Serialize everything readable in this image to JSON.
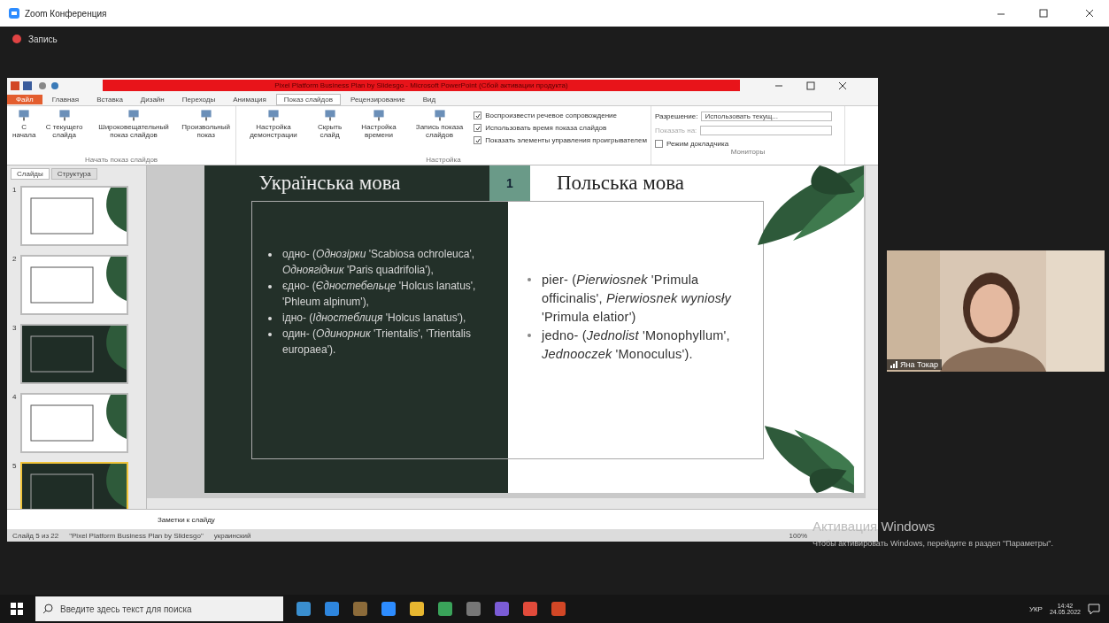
{
  "zoom": {
    "title": "Zoom Конференция",
    "record_label": "Запись"
  },
  "powerpoint": {
    "title": "Pixel Platform Business Plan by Slidesgo - Microsoft PowerPoint (Сбой активации продукта)",
    "file_tab": "Файл",
    "ribbon_tabs": [
      {
        "label": "Главная",
        "selected": false
      },
      {
        "label": "Вставка",
        "selected": false
      },
      {
        "label": "Дизайн",
        "selected": false
      },
      {
        "label": "Переходы",
        "selected": false
      },
      {
        "label": "Анимация",
        "selected": false
      },
      {
        "label": "Показ слайдов",
        "selected": true
      },
      {
        "label": "Рецензирование",
        "selected": false
      },
      {
        "label": "Вид",
        "selected": false
      }
    ],
    "groups": [
      {
        "label": "Начать показ слайдов",
        "buttons": [
          "С начала",
          "С текущего слайда",
          "Широковещательный показ слайдов",
          "Произвольный показ"
        ]
      },
      {
        "label": "Настройка",
        "buttons": [
          "Настройка демонстрации",
          "Скрыть слайд",
          "Настройка времени",
          "Запись показа слайдов"
        ],
        "checkboxes": [
          {
            "label": "Воспроизвести речевое сопровождение",
            "checked": true
          },
          {
            "label": "Использовать время показа слайдов",
            "checked": true
          },
          {
            "label": "Показать элементы управления проигрывателем",
            "checked": true
          }
        ]
      },
      {
        "label": "Мониторы",
        "resolution_label": "Разрешение:",
        "resolution_value": "Использовать текущ...",
        "show_on_label": "Показать на:",
        "presenter_mode": {
          "label": "Режим докладчика",
          "checked": false
        }
      }
    ],
    "pane_tabs": [
      {
        "label": "Слайды",
        "selected": true
      },
      {
        "label": "Структура",
        "selected": false
      }
    ],
    "thumbnails": [
      {
        "number": "1",
        "kind": "light",
        "selected": false
      },
      {
        "number": "2",
        "kind": "light",
        "selected": false
      },
      {
        "number": "3",
        "kind": "dark",
        "selected": false
      },
      {
        "number": "4",
        "kind": "light",
        "selected": false
      },
      {
        "number": "5",
        "kind": "dark",
        "selected": true
      }
    ],
    "slide": {
      "left_title": "Українська мова",
      "number": "1",
      "right_title": "Польська мова",
      "left_bullets": [
        "одно- (*Однозірки* 'Scabiosa ochroleuca', *Одноягідник* 'Paris quadrifolia'),",
        "єдно- (*Єдностебельце* 'Holcus lanatus', 'Phleum alpinum'),",
        "ідно- (*Ідностеблиця* 'Holcus lanatus'),",
        "один- (*Одинорник* 'Trientalis', 'Trientalis europaea')."
      ],
      "right_bullets": [
        "pier- (*Pierwiosnek* 'Primula officinalis', *Pierwiosnek wyniosły* 'Primula elatior')",
        "jedno- (*Jednolist* 'Monophyllum', *Jednooczek* 'Monoculus')."
      ]
    },
    "notes_placeholder": "Заметки к слайду",
    "status": [
      "Слайд 5 из 22",
      "\"Pixel Platform Business Plan by Slidesgo\"",
      "украинский"
    ],
    "zoom_level": "100%"
  },
  "participant": {
    "name": "Яна Токар"
  },
  "activation": {
    "title": "Активация Windows",
    "text": "Чтобы активировать Windows, перейдите в раздел \"Параметры\"."
  },
  "taskbar": {
    "search_placeholder": "Введите здесь текст для поиска",
    "language": "УКР",
    "time": "14:42",
    "date": "24.05.2022"
  }
}
